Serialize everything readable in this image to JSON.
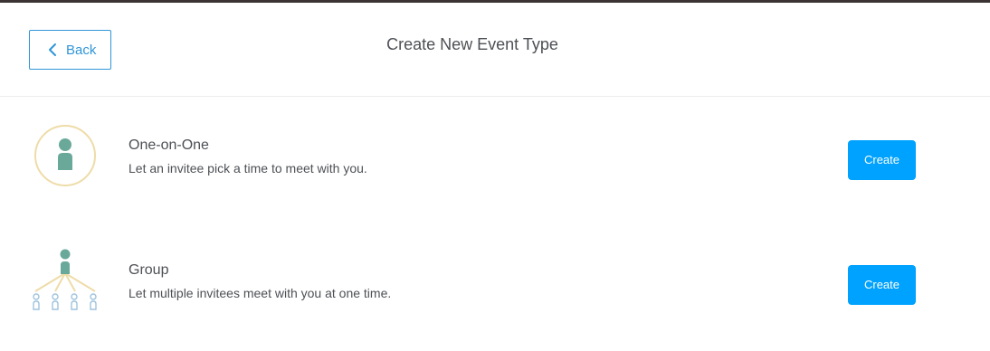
{
  "header": {
    "back_label": "Back",
    "title": "Create New Event Type"
  },
  "event_types": [
    {
      "title": "One-on-One",
      "description": "Let an invitee pick a time to meet with you.",
      "button_label": "Create",
      "icon": "one-on-one-icon"
    },
    {
      "title": "Group",
      "description": "Let multiple invitees meet with you at one time.",
      "button_label": "Create",
      "icon": "group-icon"
    }
  ],
  "colors": {
    "accent": "#00a2ff",
    "link": "#3096d8",
    "icon_teal": "#6aa99a",
    "icon_ring": "#eedca8",
    "icon_invitee": "#9fc4de"
  }
}
